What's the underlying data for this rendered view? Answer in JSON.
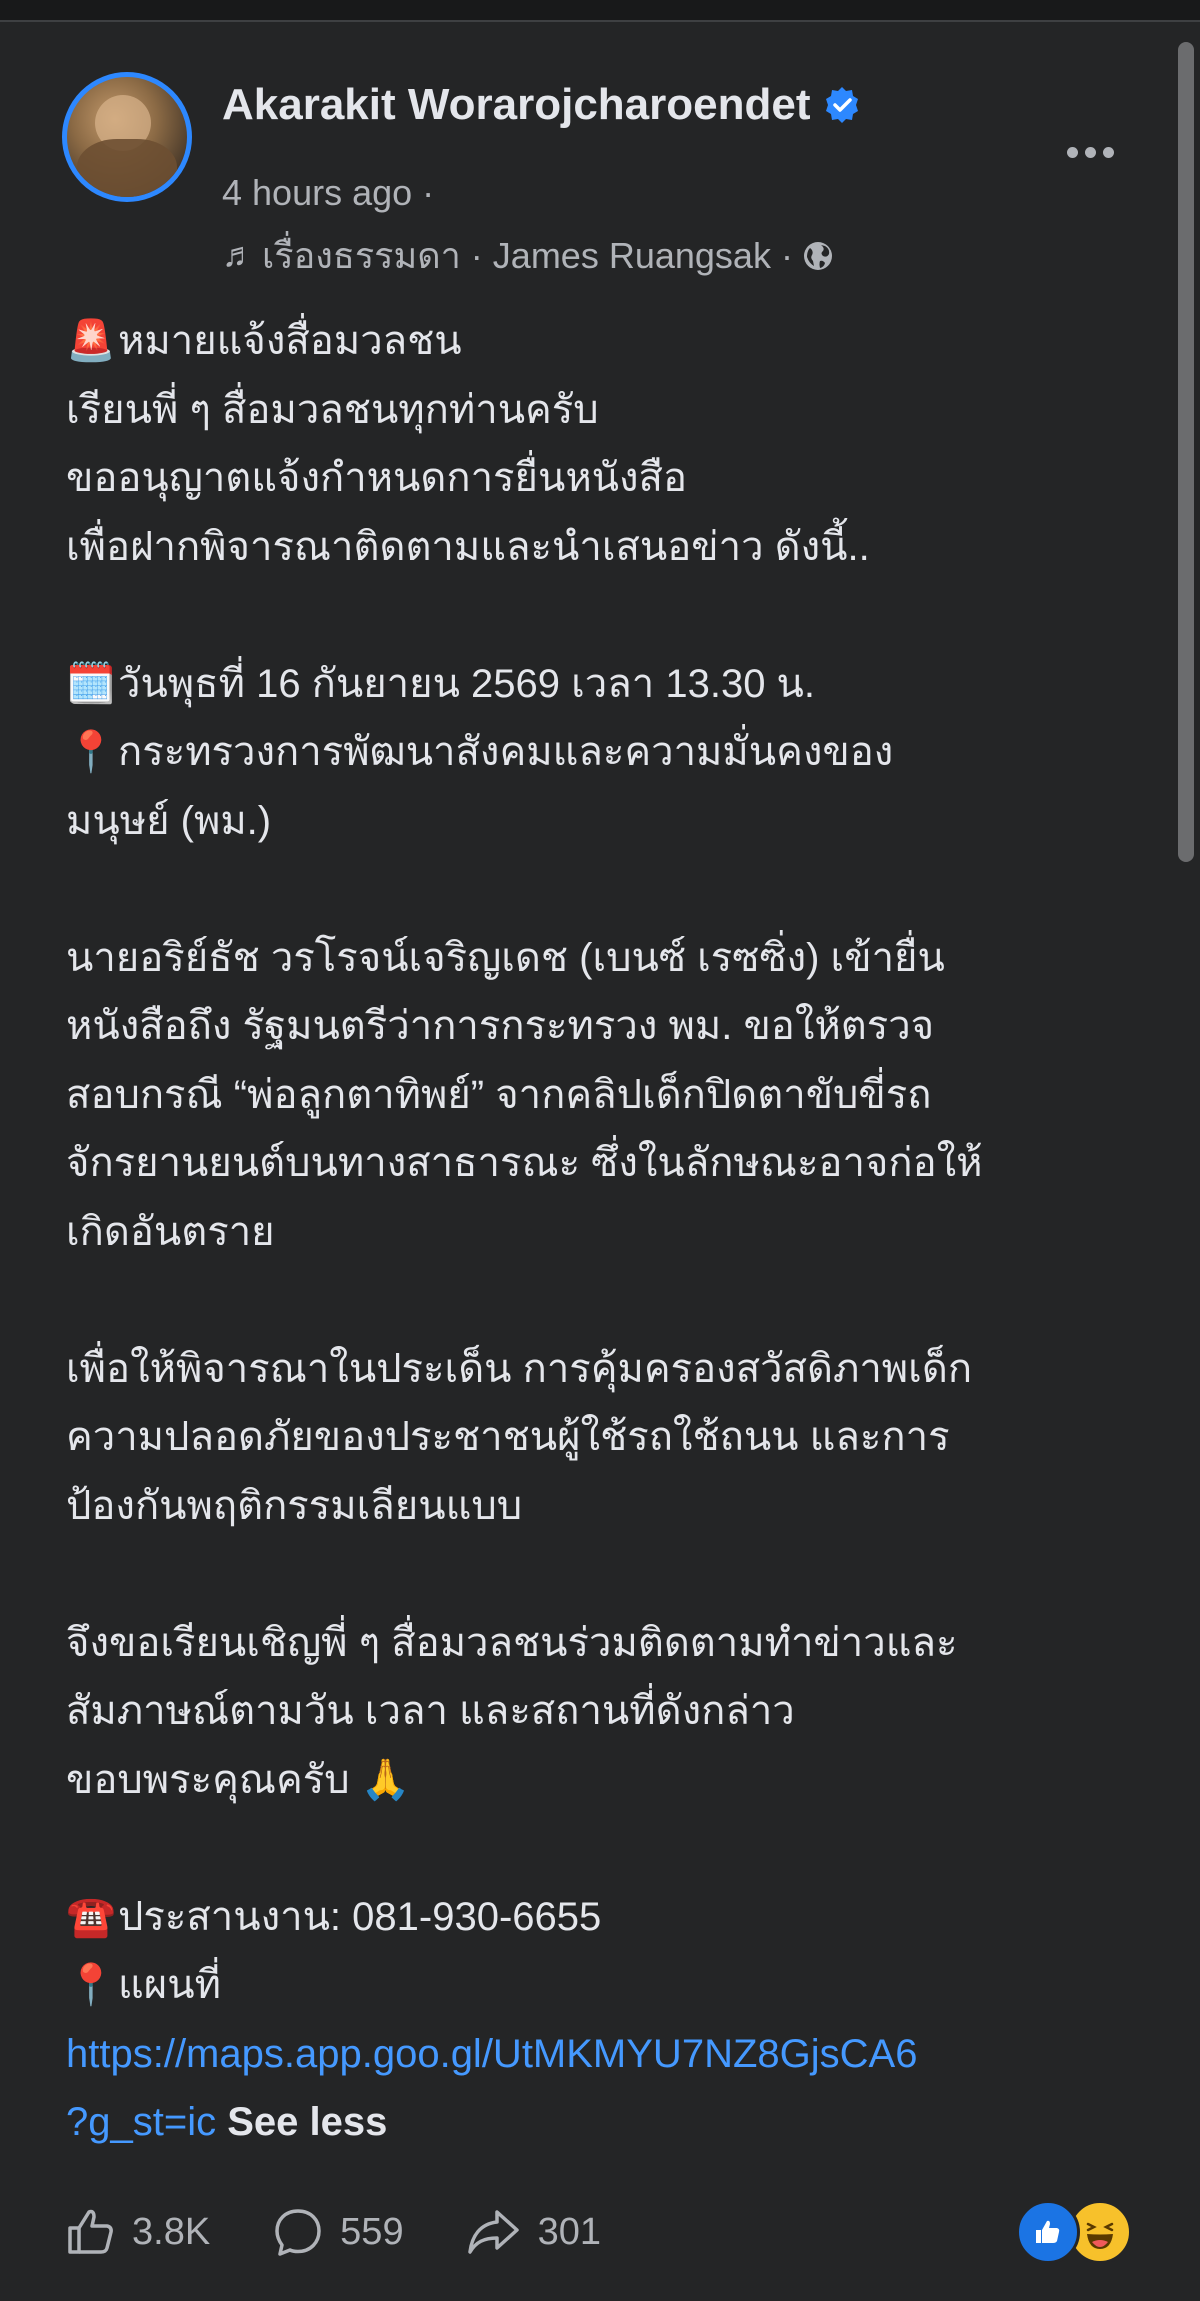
{
  "post": {
    "author": "Akarakit Worarojcharoendet",
    "time": "4 hours ago ·",
    "music": "เรื่องธรรมดา · James Ruangsak ·",
    "body": [
      {
        "emoji": "🚨",
        "text": "หมายแจ้งสื่อมวลชน"
      },
      {
        "text": "เรียนพี่ ๆ สื่อมวลชนทุกท่านครับ"
      },
      {
        "text": "ขออนุญาตแจ้งกำหนดการยื่นหนังสือ"
      },
      {
        "text": "เพื่อฝากพิจารณาติดตามและนำเสนอข่าว ดังนี้.."
      },
      {
        "blank": true
      },
      {
        "emoji": "🗓️",
        "text": "วันพุธที่ 16 กันยายน 2569 เวลา 13.30 น."
      },
      {
        "emoji": "📍",
        "text": "กระทรวงการพัฒนาสังคมและความมั่นคงของ"
      },
      {
        "text": "มนุษย์ (พม.)"
      },
      {
        "blank": true
      },
      {
        "text": "นายอริย์ธัช วรโรจน์เจริญเดช (เบนซ์ เรซซิ่ง) เข้ายื่น"
      },
      {
        "text": "หนังสือถึง รัฐมนตรีว่าการกระทรวง พม. ขอให้ตรวจ"
      },
      {
        "text": "สอบกรณี “พ่อลูกตาทิพย์” จากคลิปเด็กปิดตาขับขี่รถ"
      },
      {
        "text": "จักรยานยนต์บนทางสาธารณะ ซึ่งในลักษณะอาจก่อให้"
      },
      {
        "text": "เกิดอันตราย"
      },
      {
        "blank": true
      },
      {
        "text": "เพื่อให้พิจารณาในประเด็น การคุ้มครองสวัสดิภาพเด็ก"
      },
      {
        "text": "ความปลอดภัยของประชาชนผู้ใช้รถใช้ถนน และการ"
      },
      {
        "text": "ป้องกันพฤติกรรมเลียนแบบ"
      },
      {
        "blank": true
      },
      {
        "text": "จึงขอเรียนเชิญพี่ ๆ สื่อมวลชนร่วมติดตามทำข่าวและ"
      },
      {
        "text": "สัมภาษณ์ตามวัน เวลา และสถานที่ดังกล่าว"
      },
      {
        "text": "ขอบพระคุณครับ 🙏"
      },
      {
        "blank": true
      },
      {
        "emoji": "☎️",
        "text": "ประสานงาน: 081-930-6655"
      },
      {
        "emoji": "📍",
        "text": "แผนที่"
      }
    ],
    "link_line1": "https://maps.app.goo.gl/UtMKMYU7NZ8GjsCA6",
    "link_line2": "?g_st=ic",
    "see_less": "See less",
    "likes": "3.8K",
    "comments": "559",
    "shares": "301"
  },
  "icons": {
    "verified": "verified-badge-icon",
    "music": "music-note-icon",
    "privacy": "globe-icon",
    "more": "more-options-icon",
    "like": "thumbs-up-icon",
    "comment": "comment-bubble-icon",
    "share": "share-arrow-icon"
  },
  "colors": {
    "background": "#242526",
    "accent": "#4599ff",
    "verified": "#2d88ff"
  }
}
